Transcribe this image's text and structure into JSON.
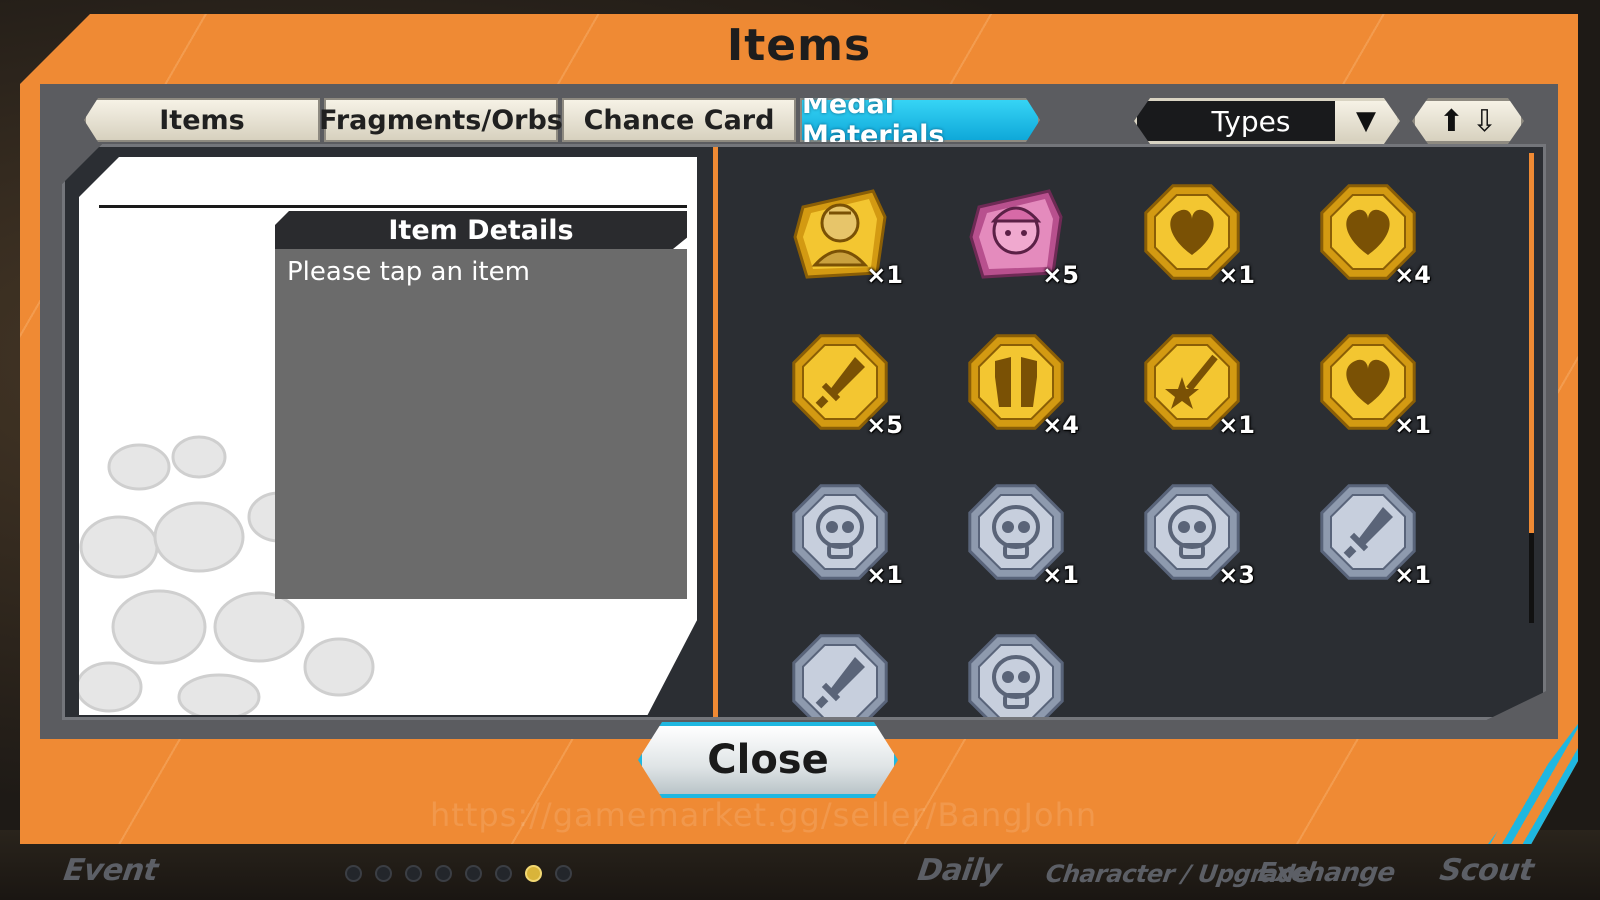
{
  "title": "Items",
  "tabs": [
    {
      "label": "Items",
      "active": false
    },
    {
      "label": "Fragments/Orbs",
      "active": false
    },
    {
      "label": "Chance Card",
      "active": false
    },
    {
      "label": "Medal Materials",
      "active": true
    }
  ],
  "filter": {
    "label": "Types",
    "arrow_icon": "chevron-down-icon"
  },
  "sort": {
    "icon_up": "arrow-up-icon",
    "icon_down": "arrow-down-icon"
  },
  "details": {
    "header": "Item Details",
    "body": "Please tap an item"
  },
  "items": [
    {
      "icon": "zoro-medal-icon",
      "color": "gold",
      "count": "×1"
    },
    {
      "icon": "chopper-medal-icon",
      "color": "pink",
      "count": "×5"
    },
    {
      "icon": "heart-medal-icon",
      "color": "gold",
      "count": "×1"
    },
    {
      "icon": "heart-medal-icon",
      "color": "gold",
      "count": "×4"
    },
    {
      "icon": "sword-medal-icon",
      "color": "gold",
      "count": "×5"
    },
    {
      "icon": "armor-medal-icon",
      "color": "gold",
      "count": "×4"
    },
    {
      "icon": "star-slash-medal-icon",
      "color": "gold",
      "count": "×1"
    },
    {
      "icon": "heart-medal-icon",
      "color": "gold",
      "count": "×1"
    },
    {
      "icon": "skull-medal-icon",
      "color": "silver",
      "count": "×1"
    },
    {
      "icon": "skull-medal-icon",
      "color": "silver",
      "count": "×1"
    },
    {
      "icon": "skull-medal-icon",
      "color": "silver",
      "count": "×3"
    },
    {
      "icon": "sword-medal-icon",
      "color": "silver",
      "count": "×1"
    },
    {
      "icon": "sword-medal-icon",
      "color": "silver",
      "count": ""
    },
    {
      "icon": "skull-medal-icon",
      "color": "silver",
      "count": ""
    }
  ],
  "close_label": "Close",
  "bottom_nav": [
    "Event",
    "Daily",
    "Character / Upgrade",
    "Exchange",
    "Scout"
  ],
  "watermark": "https://gamemarket.gg/seller/BangJohn",
  "colors": {
    "frame": "#ef8a34",
    "active_tab": "#1fb7e0",
    "panel": "#2b2e33"
  }
}
